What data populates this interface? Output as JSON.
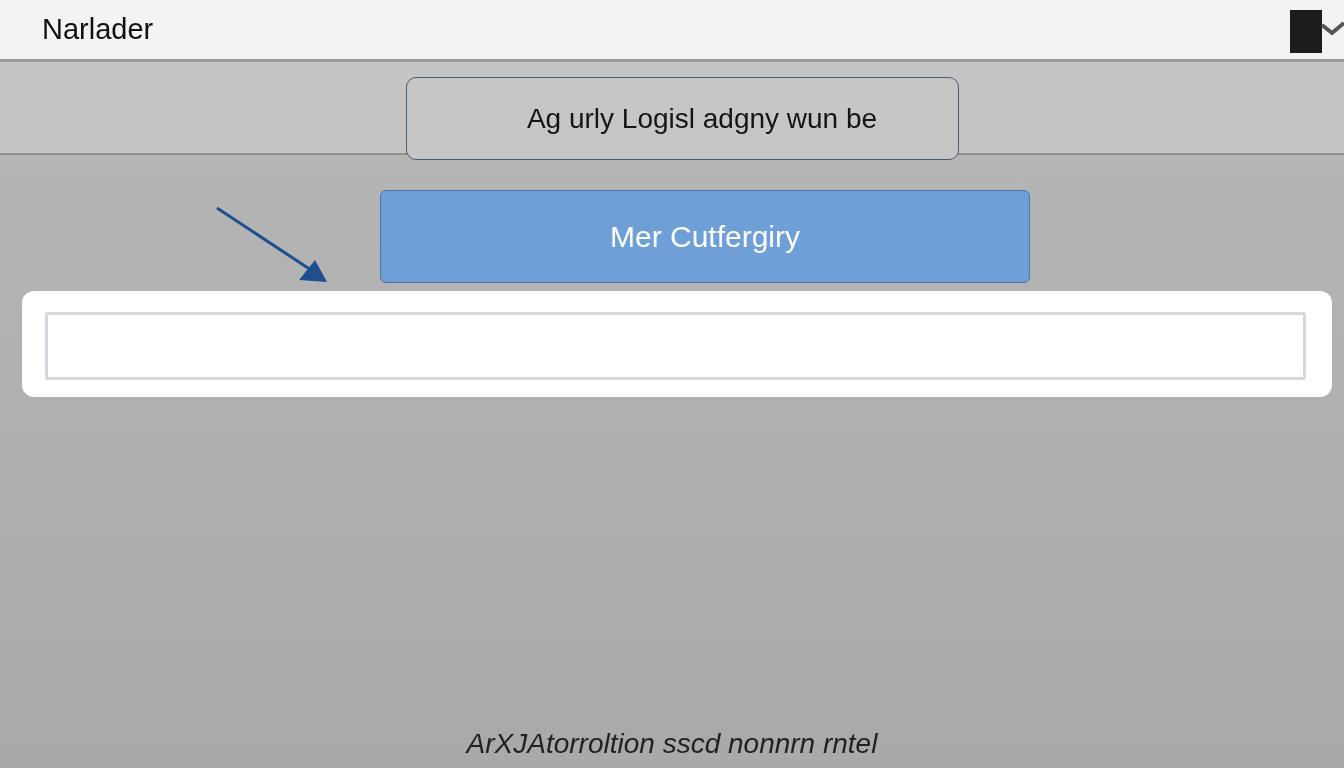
{
  "window": {
    "title": "Narlader"
  },
  "header_box": {
    "text": "Ag urly Logisl  adgny wun be"
  },
  "primary_button": {
    "label": "Mer Cutfergiry"
  },
  "footer": {
    "text": "ArXJAtorroltion sscd  nonnrn rntel"
  }
}
